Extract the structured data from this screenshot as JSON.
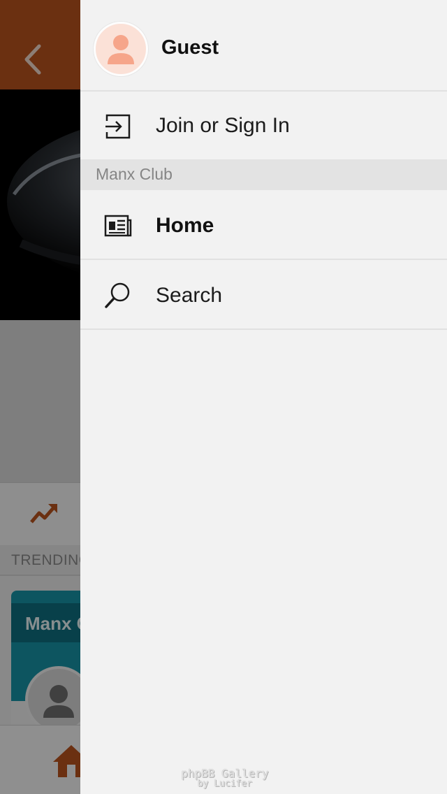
{
  "background_app": {
    "trending_label": "TRENDING",
    "card_title": "Manx C",
    "header_color": "#b9531e",
    "accent_color": "#b9531e",
    "card_color": "#1793a5",
    "icons": [
      "chevron-left-icon",
      "trending-up-icon",
      "home-icon",
      "user-icon"
    ]
  },
  "drawer": {
    "profile": {
      "name": "Guest",
      "avatar_icon": "user-icon",
      "avatar_color": "#f6a58a"
    },
    "sign_in": {
      "label": "Join or Sign In",
      "icon": "sign-in-icon"
    },
    "section": {
      "title": "Manx Club"
    },
    "items": [
      {
        "label": "Home",
        "icon": "newspaper-icon",
        "active": true
      },
      {
        "label": "Search",
        "icon": "search-icon",
        "active": false
      }
    ]
  },
  "watermark": {
    "line1": "phpBB Gallery",
    "line2": "by Lucifer"
  }
}
